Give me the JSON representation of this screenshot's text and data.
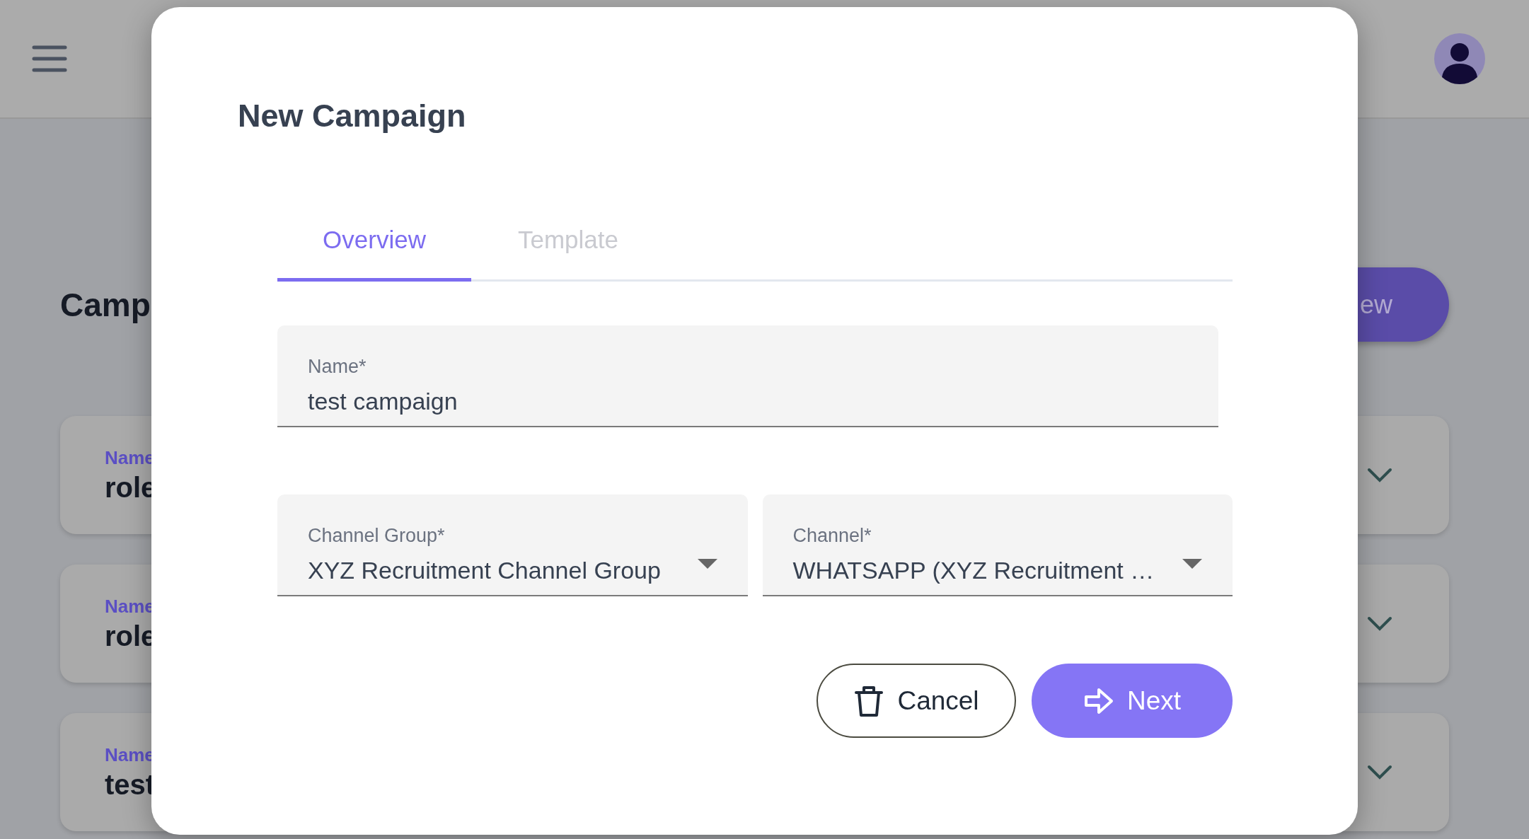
{
  "page": {
    "heading": "Camp",
    "new_button": "ew",
    "cards": [
      {
        "label": "Name",
        "value": "role"
      },
      {
        "label": "Name",
        "value": "role"
      },
      {
        "label": "Name",
        "value": "test"
      }
    ]
  },
  "dialog": {
    "title": "New Campaign",
    "tabs": [
      {
        "label": "Overview",
        "selected": true
      },
      {
        "label": "Template",
        "selected": false
      }
    ],
    "fields": [
      {
        "kind": "text",
        "label": "Name*",
        "value": "test campaign"
      },
      {
        "kind": "select",
        "label": "Channel Group*",
        "value": "XYZ Recruitment Channel Group"
      },
      {
        "kind": "select",
        "label": "Channel*",
        "value": "WHATSAPP (XYZ Recruitment …"
      }
    ],
    "buttons": [
      {
        "kind": "secondary",
        "label": "Cancel"
      },
      {
        "kind": "primary",
        "label": "Next"
      }
    ]
  }
}
